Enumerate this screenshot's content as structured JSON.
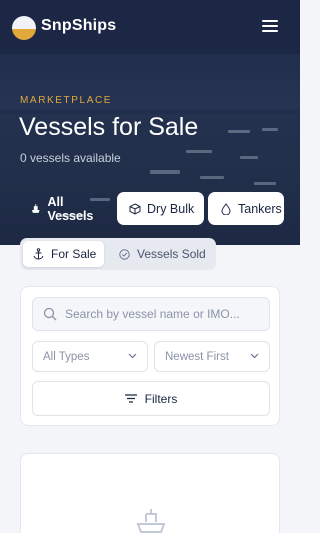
{
  "header": {
    "brand": "SnpShips",
    "logo_colors": {
      "top": "#f1f3f7",
      "bottom": "#e0a93a"
    },
    "menu_icon": "hamburger-menu-icon"
  },
  "hero": {
    "eyebrow": "MARKETPLACE",
    "title": "Vessels for Sale",
    "count_text": "0 vessels available",
    "accent": "#e0a93a"
  },
  "categories": [
    {
      "label": "All Vessels",
      "icon": "ship-icon",
      "active": true
    },
    {
      "label": "Dry Bulk",
      "icon": "cube-icon",
      "active": false
    },
    {
      "label": "Tankers",
      "icon": "droplet-icon",
      "active": false
    }
  ],
  "tabs": [
    {
      "label": "For Sale",
      "icon": "anchor-icon",
      "active": true
    },
    {
      "label": "Vessels Sold",
      "icon": "check-circle-icon",
      "active": false
    }
  ],
  "filters": {
    "search_placeholder": "Search by vessel name or IMO...",
    "type_select": "All Types",
    "sort_select": "Newest First",
    "filters_button": "Filters"
  },
  "empty_state": {
    "icon": "ship-icon"
  }
}
